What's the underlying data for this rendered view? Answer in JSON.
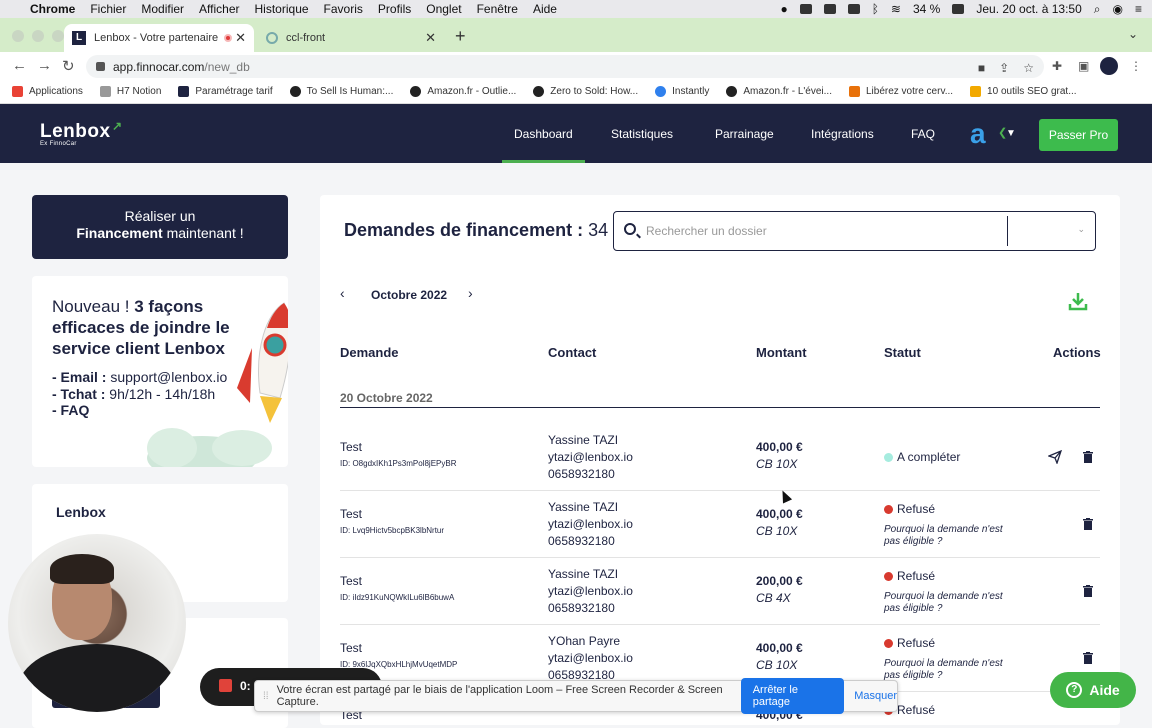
{
  "macos": {
    "menu": [
      "Chrome",
      "Fichier",
      "Modifier",
      "Afficher",
      "Historique",
      "Favoris",
      "Profils",
      "Onglet",
      "Fenêtre",
      "Aide"
    ],
    "battery": "34 %",
    "datetime": "Jeu. 20 oct. à 13:50"
  },
  "browser": {
    "tabs": [
      {
        "title": "Lenbox - Votre partenaire"
      },
      {
        "title": "ccl-front"
      }
    ],
    "url_host": "app.finnocar.com",
    "url_path": "/new_db",
    "bookmarks": [
      {
        "label": "Applications",
        "color": "#e94235"
      },
      {
        "label": "H7 Notion",
        "color": "#999999"
      },
      {
        "label": "Paramétrage tarif",
        "color": "#1e2340"
      },
      {
        "label": "To Sell Is Human:...",
        "color": "#222222"
      },
      {
        "label": "Amazon.fr - Outlie...",
        "color": "#222222"
      },
      {
        "label": "Zero to Sold: How...",
        "color": "#222222"
      },
      {
        "label": "Instantly",
        "color": "#2f80ed"
      },
      {
        "label": "Amazon.fr - L'évei...",
        "color": "#222222"
      },
      {
        "label": "Libérez votre cerv...",
        "color": "#e8710a"
      },
      {
        "label": "10 outils SEO grat...",
        "color": "#f2a900"
      }
    ]
  },
  "app": {
    "logo": "Lenbox",
    "logo_sub": "Ex FinnoCar",
    "nav": [
      "Dashboard",
      "Statistiques",
      "Parrainage",
      "Intégrations",
      "FAQ"
    ],
    "passer_pro": "Passer Pro"
  },
  "sidebar": {
    "cta_line1": "Réaliser un",
    "cta_bold": "Financement",
    "cta_rest": " maintenant !",
    "info_title_normal": "Nouveau ! ",
    "info_title_bold": "3 façons efficaces de joindre le service client Lenbox",
    "email_label": "- Email :",
    "email_value": " support@lenbox.io",
    "tchat_label": "- Tchat :",
    "tchat_value": " 9h/12h - 14h/18h",
    "faq": "- FAQ",
    "lenbox_title": "Lenbox"
  },
  "main": {
    "title": "Demandes de financement :",
    "count": "34",
    "search_placeholder": "Rechercher un dossier",
    "month": "Octobre 2022",
    "headers": [
      "Demande",
      "Contact",
      "Montant",
      "Statut",
      "Actions"
    ],
    "group": "20 Octobre 2022",
    "rows": [
      {
        "name": "Test",
        "id": "ID: O8gdxIKh1Ps3mPol8jEPyBR",
        "contact_name": "Yassine TAZI",
        "email": "ytazi@lenbox.io",
        "phone": "0658932180",
        "amount": "400,00 €",
        "plan": "CB 10X",
        "status": "A compléter",
        "status_color": "#a6ecdf",
        "note": ""
      },
      {
        "name": "Test",
        "id": "ID: Lvq9Hictv5bcpBK3lbNrtur",
        "contact_name": "Yassine TAZI",
        "email": "ytazi@lenbox.io",
        "phone": "0658932180",
        "amount": "400,00 €",
        "plan": "CB 10X",
        "status": "Refusé",
        "status_color": "#d83a2f",
        "note": "Pourquoi la demande n'est pas éligible ?"
      },
      {
        "name": "Test",
        "id": "ID: iIdz91KuNQWkILu6lB6buwA",
        "contact_name": "Yassine TAZI",
        "email": "ytazi@lenbox.io",
        "phone": "0658932180",
        "amount": "200,00 €",
        "plan": "CB 4X",
        "status": "Refusé",
        "status_color": "#d83a2f",
        "note": "Pourquoi la demande n'est pas éligible ?"
      },
      {
        "name": "Test",
        "id": "ID: 9x6lJqXQbxHLhjMvUqetMDP",
        "contact_name": "YOhan Payre",
        "email": "ytazi@lenbox.io",
        "phone": "0658932180",
        "amount": "400,00 €",
        "plan": "CB 10X",
        "status": "Refusé",
        "status_color": "#d83a2f",
        "note": "Pourquoi la demande n'est pas éligible ?"
      },
      {
        "name": "Test",
        "id": "",
        "contact_name": "",
        "email": "",
        "phone": "",
        "amount": "400,00 €",
        "plan": "",
        "status": "Refusé",
        "status_color": "#d83a2f",
        "note": ""
      }
    ]
  },
  "loom": {
    "timer": "0:",
    "message": "Votre écran est partagé par le biais de l'application Loom – Free Screen Recorder & Screen Capture.",
    "stop": "Arrêter le partage",
    "hide": "Masquer"
  },
  "help": {
    "label": "Aide"
  }
}
